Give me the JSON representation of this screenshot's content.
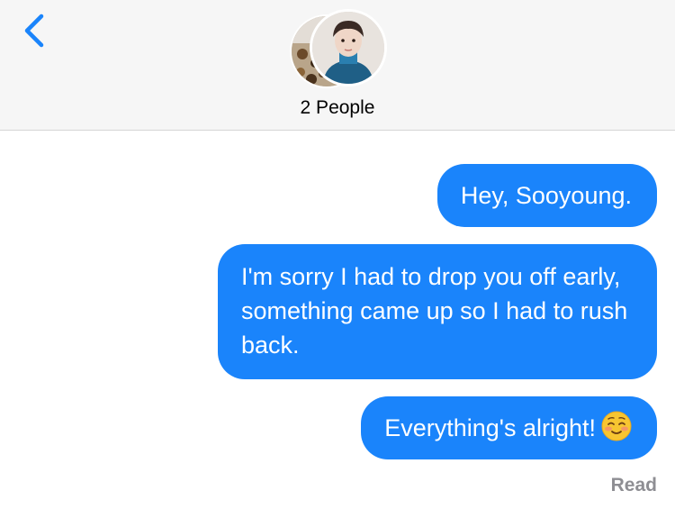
{
  "header": {
    "title": "2 People",
    "back_icon": "chevron-left-icon",
    "accent_color": "#1a84fb"
  },
  "messages": [
    {
      "text": "Hey, Sooyoung.",
      "sender": "me"
    },
    {
      "text": "I'm sorry I had to drop you off early, something came up so I had to rush back.",
      "sender": "me"
    },
    {
      "text": "Everything's alright!",
      "sender": "me",
      "emoji": "smiling-face-icon"
    }
  ],
  "status": {
    "read_label": "Read"
  },
  "colors": {
    "bubble": "#1a84fb",
    "header_bg": "#f6f6f6",
    "status_text": "#8e8e93"
  }
}
